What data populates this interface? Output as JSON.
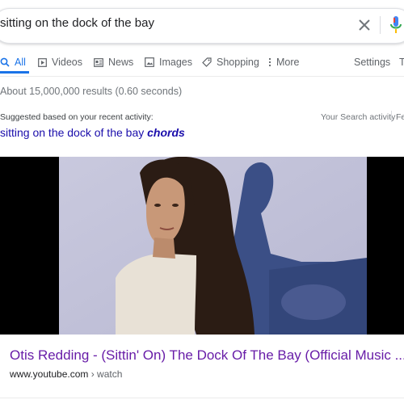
{
  "search": {
    "query": "sitting on the dock of the bay"
  },
  "icons": {
    "clear": "close-icon",
    "mic": "microphone-icon",
    "all": "search-icon",
    "videos": "play-icon",
    "news": "newspaper-icon",
    "images": "image-icon",
    "shopping": "tag-icon",
    "more": "vertical-dots-icon"
  },
  "colors": {
    "accent": "#1a73e8",
    "link": "#1a0dab",
    "visited": "#681da8"
  },
  "tabs": [
    {
      "label": "All",
      "active": true
    },
    {
      "label": "Videos"
    },
    {
      "label": "News"
    },
    {
      "label": "Images"
    },
    {
      "label": "Shopping"
    },
    {
      "label": "More"
    }
  ],
  "tools": {
    "settings": "Settings",
    "tools_partial": "T"
  },
  "results": {
    "stats": "About 15,000,000 results (0.60 seconds)",
    "suggested_label": "Suggested based on your recent activity:",
    "activity_link": "Your Search activity",
    "feedback_partial": "Fe",
    "suggestion_prefix": "sitting on the dock of the bay ",
    "suggestion_bold": "chords",
    "video_title": "Otis Redding - (Sittin' On) The Dock Of The Bay (Official Music ...",
    "video_site": "www.youtube.com",
    "video_path": " › watch"
  }
}
